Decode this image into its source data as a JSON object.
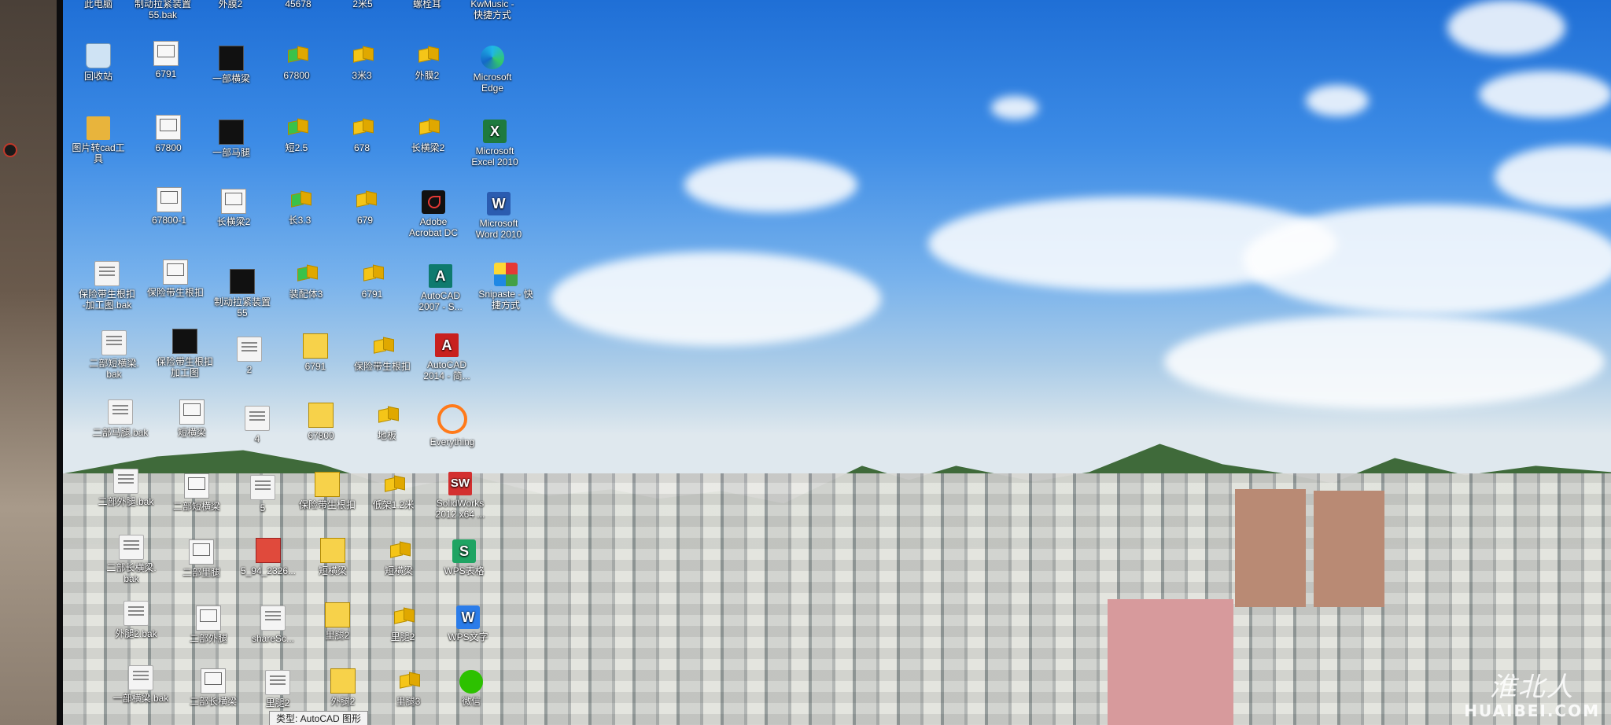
{
  "top_row": [
    "此电脑",
    "制动拉紧装置\n55.bak",
    "外膜2",
    "45678",
    "2米5",
    "螺栓耳",
    "KwMusic -\n快捷方式"
  ],
  "icons": [
    {
      "id": "recycle",
      "label": "回收站",
      "icon": "recycle-bin-icon"
    },
    {
      "id": "r1c2",
      "label": "6791",
      "icon": "drawing-file-icon"
    },
    {
      "id": "r1c3",
      "label": "一部横梁",
      "icon": "dwg-thumbnail-icon"
    },
    {
      "id": "r1c4",
      "label": "67800",
      "icon": "part-cube-icon"
    },
    {
      "id": "r1c5",
      "label": "3米3",
      "icon": "part-cube-icon"
    },
    {
      "id": "r1c6",
      "label": "外膜2",
      "icon": "part-cube-icon"
    },
    {
      "id": "edge",
      "label": "Microsoft\nEdge",
      "icon": "edge-icon"
    },
    {
      "id": "r2c1",
      "label": "图片转cad工\n具",
      "icon": "folder-icon"
    },
    {
      "id": "r2c2",
      "label": "67800",
      "icon": "drawing-file-icon"
    },
    {
      "id": "r2c3",
      "label": "一部马腿",
      "icon": "dwg-thumbnail-icon"
    },
    {
      "id": "r2c4",
      "label": "短2.5",
      "icon": "part-cube-icon"
    },
    {
      "id": "r2c5",
      "label": "678",
      "icon": "part-cube-icon"
    },
    {
      "id": "r2c6",
      "label": "长横梁2",
      "icon": "part-cube-icon"
    },
    {
      "id": "excel",
      "label": "Microsoft\nExcel 2010",
      "icon": "excel-icon"
    },
    {
      "id": "r3c2",
      "label": "67800-1",
      "icon": "drawing-file-icon"
    },
    {
      "id": "r3c3",
      "label": "长横梁2",
      "icon": "drawing-file-icon"
    },
    {
      "id": "r3c4",
      "label": "长3.3",
      "icon": "part-cube-icon"
    },
    {
      "id": "r3c5",
      "label": "679",
      "icon": "part-cube-icon"
    },
    {
      "id": "acrobat",
      "label": "Adobe\nAcrobat DC",
      "icon": "acrobat-icon"
    },
    {
      "id": "word",
      "label": "Microsoft\nWord 2010",
      "icon": "word-icon"
    },
    {
      "id": "r4c1",
      "label": "保险带生根扣\n-加工图.bak",
      "icon": "file-icon"
    },
    {
      "id": "r4c2",
      "label": "保险带生根扣",
      "icon": "drawing-file-icon"
    },
    {
      "id": "r4c3",
      "label": "制动拉紧装置\n55",
      "icon": "dwg-thumbnail-icon"
    },
    {
      "id": "r4c4",
      "label": "装配体3",
      "icon": "part-cube-icon"
    },
    {
      "id": "r4c5",
      "label": "6791",
      "icon": "part-cube-icon"
    },
    {
      "id": "autocad2007",
      "label": "AutoCAD\n2007 - S...",
      "icon": "autocad-icon"
    },
    {
      "id": "snipaste",
      "label": "Snipaste - 快\n捷方式",
      "icon": "snipaste-icon"
    },
    {
      "id": "r5c1",
      "label": "二部短横梁.\nbak",
      "icon": "file-icon"
    },
    {
      "id": "r5c2",
      "label": "保险带生根扣\n加工图",
      "icon": "dwg-thumbnail-icon"
    },
    {
      "id": "r5c3",
      "label": "2",
      "icon": "file-icon"
    },
    {
      "id": "r5c4",
      "label": "6791",
      "icon": "assembly-icon"
    },
    {
      "id": "r5c5",
      "label": "保险带生根扣",
      "icon": "part-cube-icon"
    },
    {
      "id": "autocad2014",
      "label": "AutoCAD\n2014 - 简...",
      "icon": "autocad-red-icon"
    },
    {
      "id": "r6c1",
      "label": "二部马腿.bak",
      "icon": "file-icon"
    },
    {
      "id": "r6c2",
      "label": "短横梁",
      "icon": "drawing-file-icon"
    },
    {
      "id": "r6c3",
      "label": "4",
      "icon": "file-icon"
    },
    {
      "id": "r6c4",
      "label": "67800",
      "icon": "assembly-icon"
    },
    {
      "id": "r6c5",
      "label": "地板",
      "icon": "part-cube-icon"
    },
    {
      "id": "everything",
      "label": "Everything",
      "icon": "everything-icon"
    },
    {
      "id": "r7c1",
      "label": "二部外腿.bak",
      "icon": "file-icon"
    },
    {
      "id": "r7c2",
      "label": "二部短横梁",
      "icon": "drawing-file-icon"
    },
    {
      "id": "r7c3",
      "label": "5",
      "icon": "file-icon"
    },
    {
      "id": "r7c4",
      "label": "保险带生根扣",
      "icon": "assembly-icon"
    },
    {
      "id": "r7c5",
      "label": "低架1.2米",
      "icon": "part-cube-icon"
    },
    {
      "id": "solidworks",
      "label": "SolidWorks\n2012 x64 ...",
      "icon": "solidworks-icon"
    },
    {
      "id": "r8c1",
      "label": "二部长横梁.\nbak",
      "icon": "file-icon"
    },
    {
      "id": "r8c2",
      "label": "二部里腿",
      "icon": "drawing-file-icon"
    },
    {
      "id": "r8c3",
      "label": "5_94_2326...",
      "icon": "image-file-icon"
    },
    {
      "id": "r8c4",
      "label": "短横梁",
      "icon": "assembly-icon"
    },
    {
      "id": "r8c5",
      "label": "短横梁",
      "icon": "part-cube-icon"
    },
    {
      "id": "wps",
      "label": "WPS表格",
      "icon": "wps-sheet-icon"
    },
    {
      "id": "r9c1",
      "label": "外腿2.bak",
      "icon": "file-icon"
    },
    {
      "id": "r9c2",
      "label": "二部外腿",
      "icon": "drawing-file-icon"
    },
    {
      "id": "r9c3",
      "label": "shareSc...",
      "icon": "file-icon"
    },
    {
      "id": "r9c4",
      "label": "里腿2",
      "icon": "assembly-icon"
    },
    {
      "id": "r9c5",
      "label": "里腿2",
      "icon": "part-cube-icon"
    },
    {
      "id": "wpsword",
      "label": "WPS文字",
      "icon": "wps-writer-icon"
    },
    {
      "id": "r10c1",
      "label": "一部横梁.bak",
      "icon": "file-icon"
    },
    {
      "id": "r10c2",
      "label": "二部长横梁",
      "icon": "drawing-file-icon"
    },
    {
      "id": "r10c3",
      "label": "里腿2",
      "icon": "file-icon"
    },
    {
      "id": "r10c4",
      "label": "外腿2",
      "icon": "assembly-icon"
    },
    {
      "id": "r10c5",
      "label": "里腿3",
      "icon": "part-cube-icon"
    },
    {
      "id": "wechat",
      "label": "微信",
      "icon": "wechat-icon"
    }
  ],
  "tooltip": "类型: AutoCAD 图形",
  "watermark": {
    "line1": "淮北人",
    "line2": "HUAIBEI.COM"
  }
}
